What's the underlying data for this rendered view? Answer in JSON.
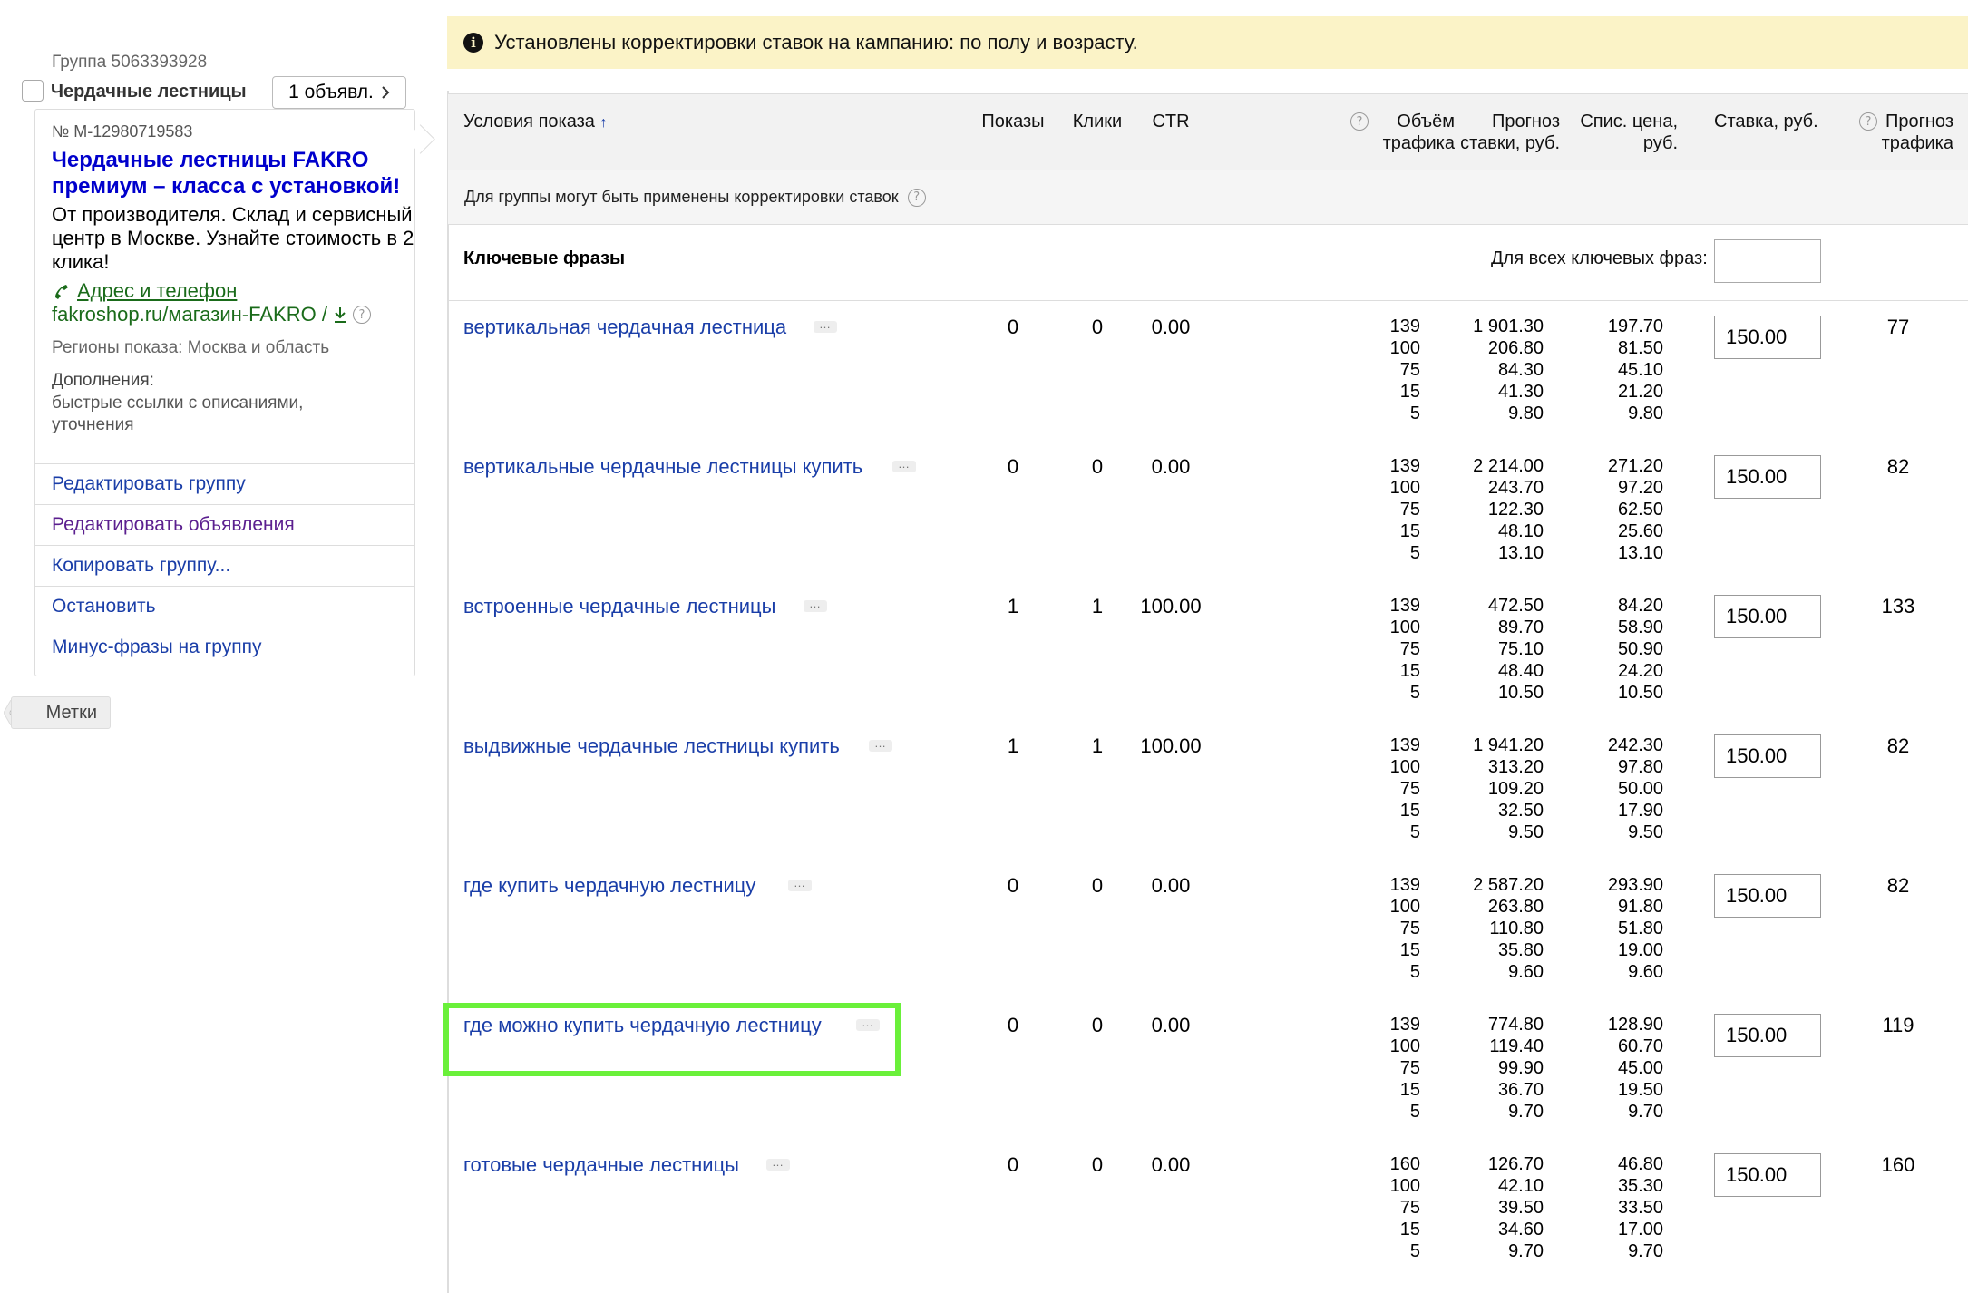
{
  "notice": {
    "text": "Установлены корректировки ставок на кампанию: по полу и возрасту."
  },
  "group": {
    "id_label": "Группа 5063393928",
    "name": "Чердачные лестницы",
    "ads_button": "1 объявл."
  },
  "ad": {
    "number": "№ M-12980719583",
    "title": "Чердачные лестницы FAKRO премиум – класса с установкой!",
    "text": "От производителя. Склад и сервисный центр в Москве. Узнайте стоимость в 2 клика!",
    "contact_link": "Адрес и телефон",
    "display_url": "fakroshop.ru/магазин-FAKRO /",
    "regions": "Регионы показа: Москва и область",
    "extras_label": "Дополнения:",
    "extras_value": "быстрые ссылки с описаниями, уточнения"
  },
  "group_menu": [
    {
      "label": "Редактировать группу"
    },
    {
      "label": "Редактировать объявления"
    },
    {
      "label": "Копировать группу..."
    },
    {
      "label": "Остановить"
    },
    {
      "label": "Минус-фразы на группу"
    }
  ],
  "tags_button": "Метки",
  "table": {
    "headers": {
      "conditions": "Условия показа",
      "sort_arrow": "↑",
      "impressions": "Показы",
      "clicks": "Клики",
      "ctr": "CTR",
      "traffic_volume": "Объём трафика",
      "bid_forecast": "Прогноз ставки, руб.",
      "debit_price": "Спис. цена, руб.",
      "bid": "Ставка, руб.",
      "traffic_forecast": "Прогноз трафика"
    },
    "adjustments_note": "Для группы могут быть применены корректировки ставок",
    "keywords_label": "Ключевые фразы",
    "all_keywords_label": "Для всех ключевых фраз:",
    "all_keywords_value": "",
    "rows": [
      {
        "phrase": "вертикальная чердачная лестница",
        "impressions": "0",
        "clicks": "0",
        "ctr": "0.00",
        "volume": [
          "139",
          "100",
          "75",
          "15",
          "5"
        ],
        "forecast": [
          "1 901.30",
          "206.80",
          "84.30",
          "41.30",
          "9.80"
        ],
        "price": [
          "197.70",
          "81.50",
          "45.10",
          "21.20",
          "9.80"
        ],
        "bid": "150.00",
        "traffic": "77"
      },
      {
        "phrase": "вертикальные чердачные лестницы купить",
        "impressions": "0",
        "clicks": "0",
        "ctr": "0.00",
        "volume": [
          "139",
          "100",
          "75",
          "15",
          "5"
        ],
        "forecast": [
          "2 214.00",
          "243.70",
          "122.30",
          "48.10",
          "13.10"
        ],
        "price": [
          "271.20",
          "97.20",
          "62.50",
          "25.60",
          "13.10"
        ],
        "bid": "150.00",
        "traffic": "82"
      },
      {
        "phrase": "встроенные чердачные лестницы",
        "impressions": "1",
        "clicks": "1",
        "ctr": "100.00",
        "volume": [
          "139",
          "100",
          "75",
          "15",
          "5"
        ],
        "forecast": [
          "472.50",
          "89.70",
          "75.10",
          "48.40",
          "10.50"
        ],
        "price": [
          "84.20",
          "58.90",
          "50.90",
          "24.20",
          "10.50"
        ],
        "bid": "150.00",
        "traffic": "133"
      },
      {
        "phrase": "выдвижные чердачные лестницы купить",
        "impressions": "1",
        "clicks": "1",
        "ctr": "100.00",
        "volume": [
          "139",
          "100",
          "75",
          "15",
          "5"
        ],
        "forecast": [
          "1 941.20",
          "313.20",
          "109.20",
          "32.50",
          "9.50"
        ],
        "price": [
          "242.30",
          "97.80",
          "50.00",
          "17.90",
          "9.50"
        ],
        "bid": "150.00",
        "traffic": "82"
      },
      {
        "phrase": "где купить чердачную лестницу",
        "impressions": "0",
        "clicks": "0",
        "ctr": "0.00",
        "volume": [
          "139",
          "100",
          "75",
          "15",
          "5"
        ],
        "forecast": [
          "2 587.20",
          "263.80",
          "110.80",
          "35.80",
          "9.60"
        ],
        "price": [
          "293.90",
          "91.80",
          "51.80",
          "19.00",
          "9.60"
        ],
        "bid": "150.00",
        "traffic": "82"
      },
      {
        "phrase": "где можно купить чердачную лестницу",
        "impressions": "0",
        "clicks": "0",
        "ctr": "0.00",
        "volume": [
          "139",
          "100",
          "75",
          "15",
          "5"
        ],
        "forecast": [
          "774.80",
          "119.40",
          "99.90",
          "36.70",
          "9.70"
        ],
        "price": [
          "128.90",
          "60.70",
          "45.00",
          "19.50",
          "9.70"
        ],
        "bid": "150.00",
        "traffic": "119",
        "highlighted": true
      },
      {
        "phrase": "готовые чердачные лестницы",
        "impressions": "0",
        "clicks": "0",
        "ctr": "0.00",
        "volume": [
          "160",
          "100",
          "75",
          "15",
          "5"
        ],
        "forecast": [
          "126.70",
          "42.10",
          "39.50",
          "34.60",
          "9.70"
        ],
        "price": [
          "46.80",
          "35.30",
          "33.50",
          "17.00",
          "9.70"
        ],
        "bid": "150.00",
        "traffic": "160"
      }
    ]
  },
  "colors": {
    "notice_bg": "#fbf3c7",
    "link": "#1a3ea8",
    "highlight": "#6af03a"
  }
}
